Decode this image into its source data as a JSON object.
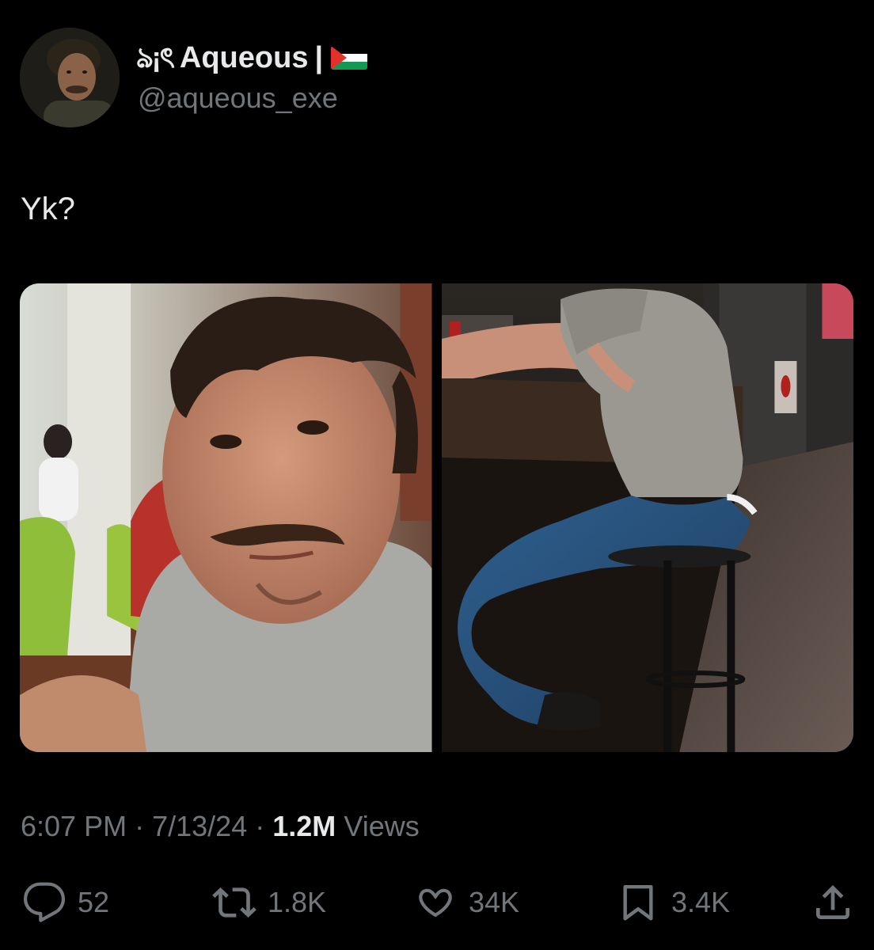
{
  "author": {
    "name_decoration": "ঌ¡ৎ",
    "display_name": "Aqueous",
    "separator": "|",
    "flag_icon": "palestine-flag-icon",
    "handle": "@aqueous_exe",
    "avatar_icon": "profile-avatar"
  },
  "tweet": {
    "text": "Yk?"
  },
  "media": {
    "photos": [
      {
        "icon": "photo-man-selfie-grey-tshirt"
      },
      {
        "icon": "photo-man-on-bar-stool"
      }
    ]
  },
  "meta": {
    "time": "6:07 PM",
    "dot1": "·",
    "date": "7/13/24",
    "dot2": "·",
    "views_count": "1.2M",
    "views_label": "Views"
  },
  "actions": {
    "reply": {
      "count": "52",
      "icon": "reply-icon"
    },
    "retweet": {
      "count": "1.8K",
      "icon": "retweet-icon"
    },
    "like": {
      "count": "34K",
      "icon": "heart-icon"
    },
    "bookmark": {
      "count": "3.4K",
      "icon": "bookmark-icon"
    },
    "share": {
      "icon": "share-icon"
    }
  },
  "colors": {
    "background": "#000000",
    "primary_text": "#e7e9ea",
    "secondary_text": "#71767b"
  }
}
